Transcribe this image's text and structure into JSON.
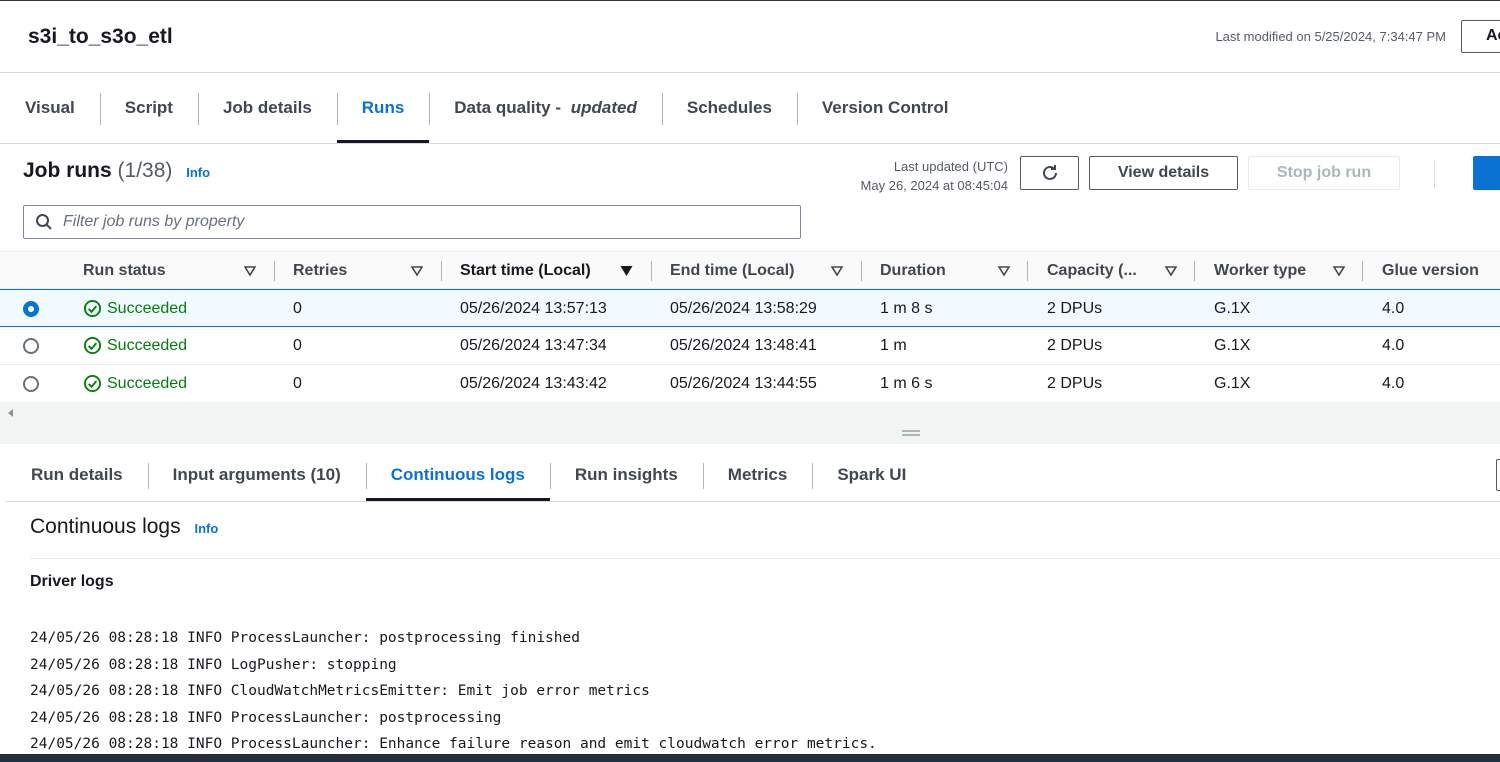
{
  "header": {
    "job_title": "s3i_to_s3o_etl",
    "last_modified": "Last modified on 5/25/2024, 7:34:47 PM",
    "actions_label": "Ac"
  },
  "top_tabs": [
    {
      "label": "Visual"
    },
    {
      "label": "Script"
    },
    {
      "label": "Job details"
    },
    {
      "label": "Runs"
    },
    {
      "label": "Data quality - ",
      "suffix": "updated"
    },
    {
      "label": "Schedules"
    },
    {
      "label": "Version Control"
    }
  ],
  "job_runs": {
    "title": "Job runs",
    "count": "(1/38)",
    "info": "Info",
    "last_updated_label": "Last updated (UTC)",
    "last_updated_value": "May 26, 2024 at 08:45:04",
    "view_details": "View details",
    "stop_job_run": "Stop job run",
    "filter_placeholder": "Filter job runs by property"
  },
  "table": {
    "columns": [
      "Run status",
      "Retries",
      "Start time (Local)",
      "End time (Local)",
      "Duration",
      "Capacity (...",
      "Worker type",
      "Glue version"
    ],
    "rows": [
      {
        "status": "Succeeded",
        "retries": "0",
        "start": "05/26/2024 13:57:13",
        "end": "05/26/2024 13:58:29",
        "duration": "1 m 8 s",
        "capacity": "2 DPUs",
        "worker": "G.1X",
        "glue": "4.0"
      },
      {
        "status": "Succeeded",
        "retries": "0",
        "start": "05/26/2024 13:47:34",
        "end": "05/26/2024 13:48:41",
        "duration": "1 m",
        "capacity": "2 DPUs",
        "worker": "G.1X",
        "glue": "4.0"
      },
      {
        "status": "Succeeded",
        "retries": "0",
        "start": "05/26/2024 13:43:42",
        "end": "05/26/2024 13:44:55",
        "duration": "1 m 6 s",
        "capacity": "2 DPUs",
        "worker": "G.1X",
        "glue": "4.0"
      }
    ]
  },
  "bottom_tabs": [
    {
      "label": "Run details"
    },
    {
      "label": "Input arguments (10)"
    },
    {
      "label": "Continuous logs"
    },
    {
      "label": "Run insights"
    },
    {
      "label": "Metrics"
    },
    {
      "label": "Spark UI"
    }
  ],
  "logs": {
    "title": "Continuous logs",
    "info": "Info",
    "driver_logs": "Driver logs",
    "lines": [
      "24/05/26 08:28:18 INFO ProcessLauncher: postprocessing finished",
      "24/05/26 08:28:18 INFO LogPusher: stopping",
      "24/05/26 08:28:18 INFO CloudWatchMetricsEmitter: Emit job error metrics",
      "24/05/26 08:28:18 INFO ProcessLauncher: postprocessing",
      "24/05/26 08:28:18 INFO ProcessLauncher: Enhance failure reason and emit cloudwatch error metrics."
    ]
  },
  "colors": {
    "accent": "#0972d3",
    "success": "#037f0c",
    "text": "#16191f"
  }
}
